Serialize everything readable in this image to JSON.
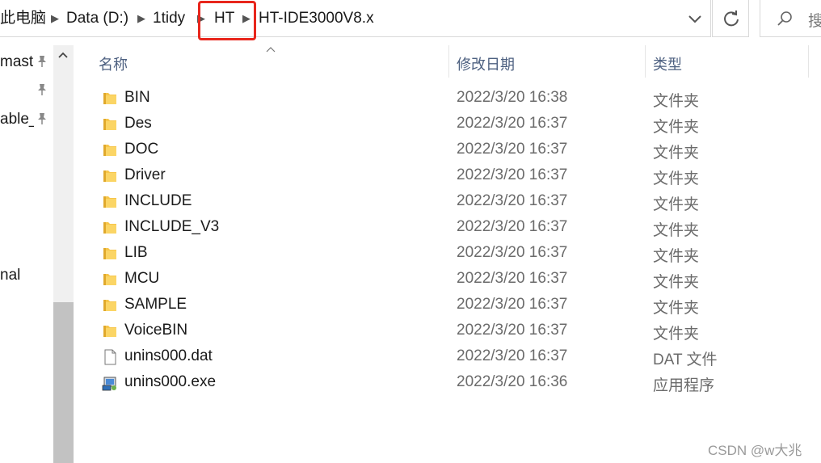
{
  "address_bar": {
    "crumbs": [
      "此电脑",
      "Data (D:)",
      "1tidy",
      "HT",
      "HT-IDE3000V8.x"
    ]
  },
  "search": {
    "label": "搜"
  },
  "nav_pane": {
    "items": [
      "maste",
      "",
      "able_",
      "nal"
    ]
  },
  "columns": {
    "name": "名称",
    "date": "修改日期",
    "type": "类型"
  },
  "files": [
    {
      "name": "BIN",
      "date": "2022/3/20 16:38",
      "type": "文件夹",
      "icon": "folder-icon"
    },
    {
      "name": "Des",
      "date": "2022/3/20 16:37",
      "type": "文件夹",
      "icon": "folder-icon"
    },
    {
      "name": "DOC",
      "date": "2022/3/20 16:37",
      "type": "文件夹",
      "icon": "folder-icon"
    },
    {
      "name": "Driver",
      "date": "2022/3/20 16:37",
      "type": "文件夹",
      "icon": "folder-icon"
    },
    {
      "name": "INCLUDE",
      "date": "2022/3/20 16:37",
      "type": "文件夹",
      "icon": "folder-icon"
    },
    {
      "name": "INCLUDE_V3",
      "date": "2022/3/20 16:37",
      "type": "文件夹",
      "icon": "folder-icon"
    },
    {
      "name": "LIB",
      "date": "2022/3/20 16:37",
      "type": "文件夹",
      "icon": "folder-icon"
    },
    {
      "name": "MCU",
      "date": "2022/3/20 16:37",
      "type": "文件夹",
      "icon": "folder-icon"
    },
    {
      "name": "SAMPLE",
      "date": "2022/3/20 16:37",
      "type": "文件夹",
      "icon": "folder-icon"
    },
    {
      "name": "VoiceBIN",
      "date": "2022/3/20 16:37",
      "type": "文件夹",
      "icon": "folder-icon"
    },
    {
      "name": "unins000.dat",
      "date": "2022/3/20 16:37",
      "type": "DAT 文件",
      "icon": "file-icon"
    },
    {
      "name": "unins000.exe",
      "date": "2022/3/20 16:36",
      "type": "应用程序",
      "icon": "installer-icon"
    }
  ],
  "watermark": "CSDN @w大兆",
  "colors": {
    "highlight": "#e8261c",
    "folder": "#f7c64a",
    "header_text": "#4d6080"
  }
}
